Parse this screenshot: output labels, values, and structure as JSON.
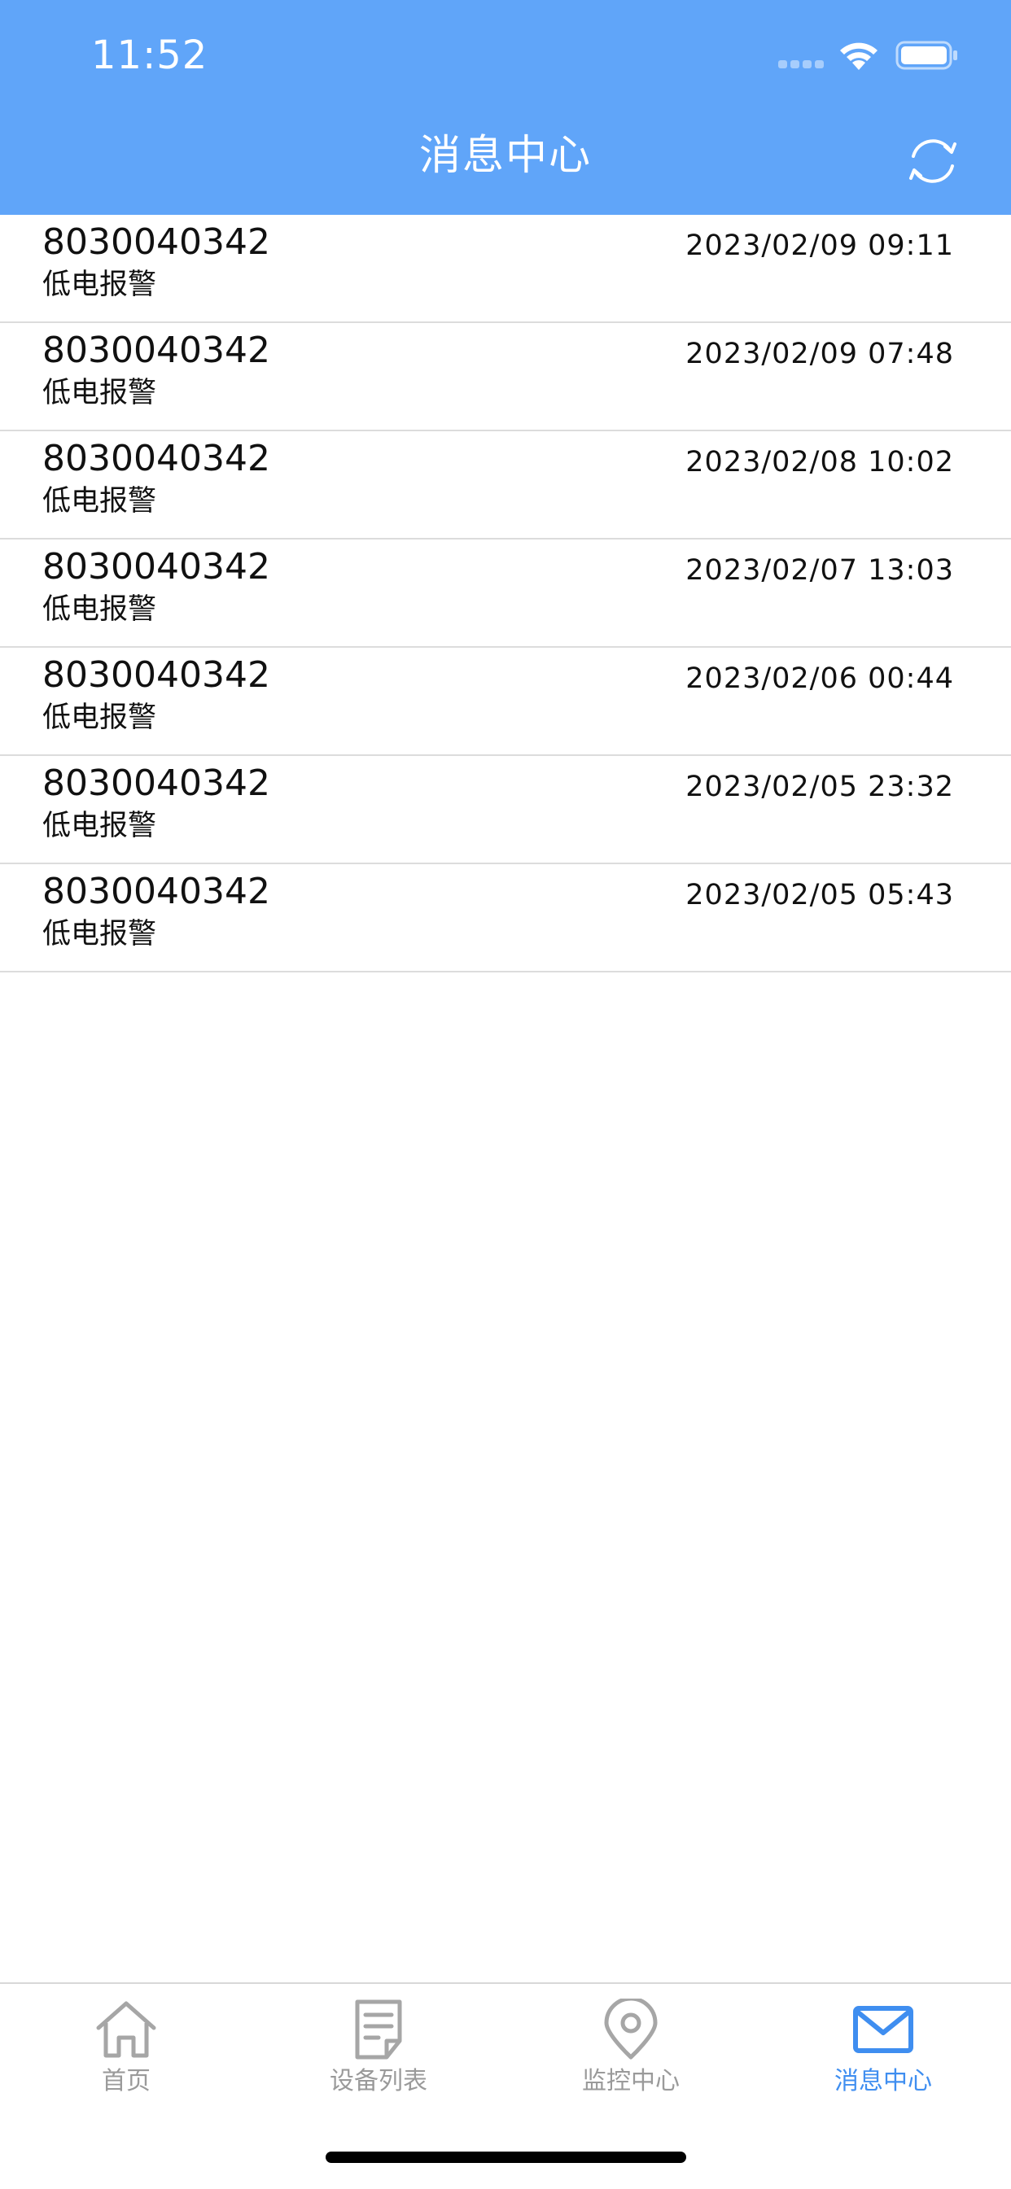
{
  "status_bar": {
    "time": "11:52"
  },
  "nav": {
    "title": "消息中心",
    "refresh_icon": "refresh-icon"
  },
  "messages": [
    {
      "id": "8030040342",
      "type": "低电报警",
      "time": "2023/02/09 09:11"
    },
    {
      "id": "8030040342",
      "type": "低电报警",
      "time": "2023/02/09 07:48"
    },
    {
      "id": "8030040342",
      "type": "低电报警",
      "time": "2023/02/08 10:02"
    },
    {
      "id": "8030040342",
      "type": "低电报警",
      "time": "2023/02/07 13:03"
    },
    {
      "id": "8030040342",
      "type": "低电报警",
      "time": "2023/02/06 00:44"
    },
    {
      "id": "8030040342",
      "type": "低电报警",
      "time": "2023/02/05 23:32"
    },
    {
      "id": "8030040342",
      "type": "低电报警",
      "time": "2023/02/05 05:43"
    }
  ],
  "tabbar": {
    "tabs": [
      {
        "label": "首页",
        "icon": "home-icon",
        "active": false
      },
      {
        "label": "设备列表",
        "icon": "document-list-icon",
        "active": false
      },
      {
        "label": "监控中心",
        "icon": "location-pin-icon",
        "active": false
      },
      {
        "label": "消息中心",
        "icon": "mail-icon",
        "active": true
      }
    ]
  },
  "colors": {
    "header": "#60a5f9",
    "tab_active": "#3f8ef0",
    "tab_inactive": "#9a9a9a"
  }
}
